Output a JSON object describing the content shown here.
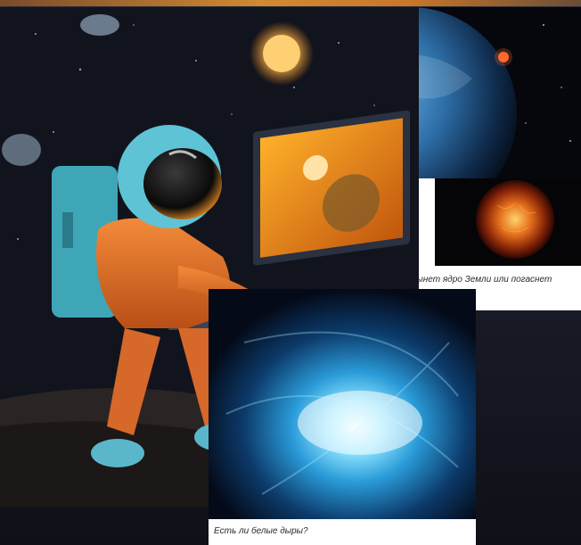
{
  "articles": [
    {
      "caption": "Что произойдет раньше: остынет ядро Земли или погаснет"
    },
    {
      "caption": "Есть ли белые дыры?"
    }
  ],
  "image_subjects": {
    "main": "astronaut-at-laptop",
    "planet": "earth-from-space",
    "sun": "burning-sun",
    "blackhole": "white-hole-vortex"
  },
  "colors": {
    "space_dark": "#0b0d16",
    "suit_orange": "#e8742a",
    "helmet_cyan": "#5fc3d6",
    "screen_orange": "#f39a1e",
    "vortex_cyan": "#49c6ff"
  }
}
